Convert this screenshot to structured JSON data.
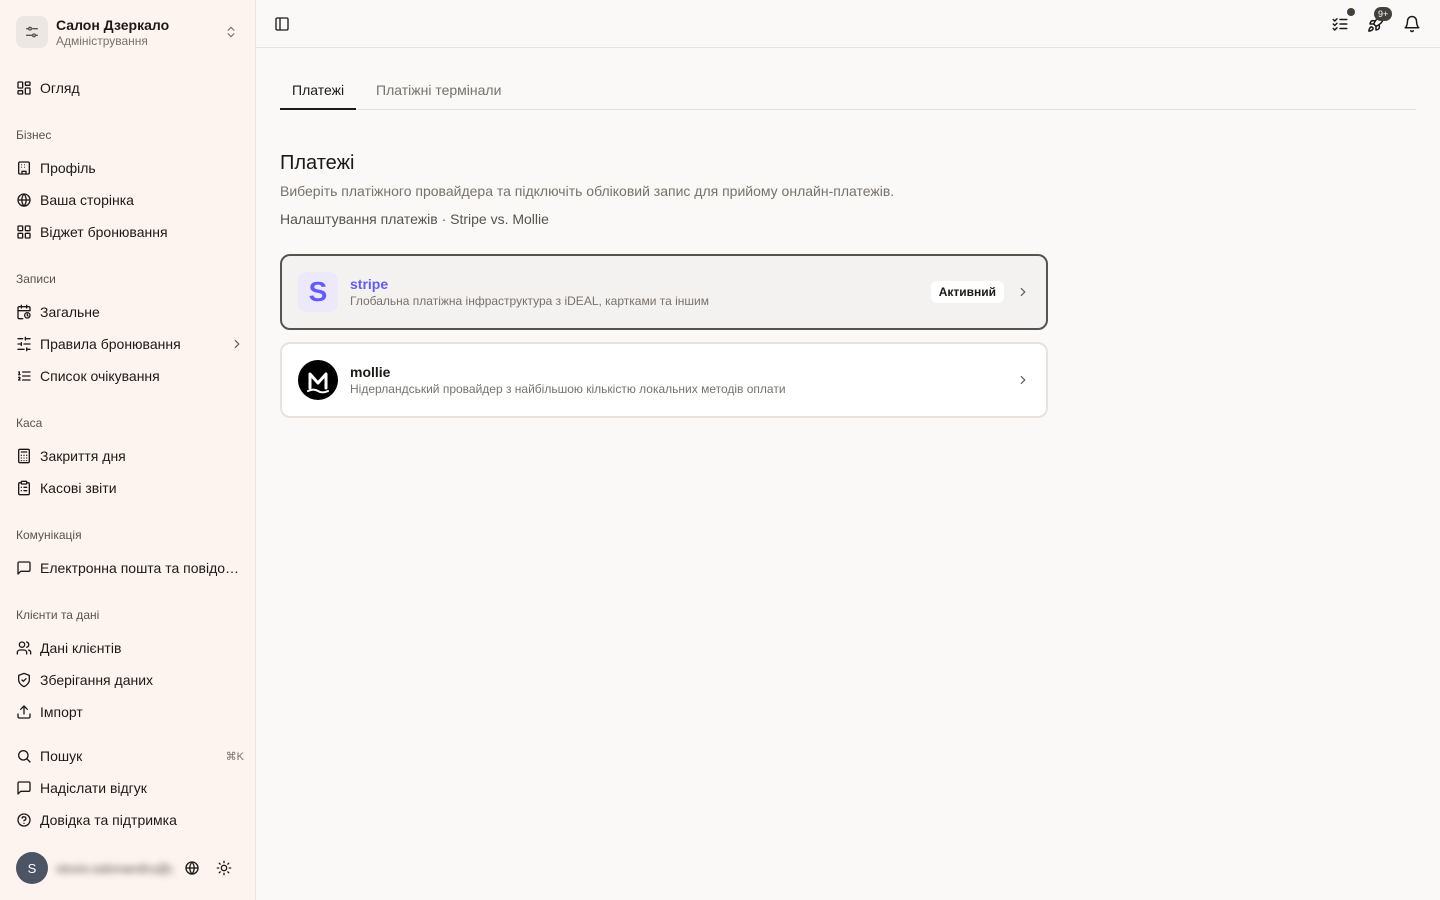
{
  "org": {
    "name": "Салон Дзеркало",
    "role": "Адміністрування"
  },
  "nav": {
    "overview": "Огляд",
    "sections": {
      "business": "Бізнес",
      "appointments": "Записи",
      "cashier": "Каса",
      "communication": "Комунікація",
      "clients_data": "Клієнти та дані"
    },
    "business": [
      "Профіль",
      "Ваша сторінка",
      "Віджет бронювання"
    ],
    "appointments": [
      "Загальне",
      "Правила бронювання",
      "Список очікування"
    ],
    "cashier": [
      "Закриття дня",
      "Касові звіти"
    ],
    "communication": [
      "Електронна пошта та повідомлення"
    ],
    "clients_data": [
      "Дані клієнтів",
      "Зберігання даних",
      "Імпорт"
    ],
    "footer": {
      "search": "Пошук",
      "search_shortcut": "⌘K",
      "feedback": "Надіслати відгук",
      "help": "Довідка та підтримка"
    }
  },
  "user": {
    "initial": "S",
    "email": "stoxiv.salonandru@gmail.com"
  },
  "topbar": {
    "notifications_badge": "9+"
  },
  "tabs": [
    "Платежі",
    "Платіжні термінали"
  ],
  "page": {
    "title": "Платежі",
    "description": "Виберіть платіжного провайдера та підключіть обліковий запис для прийому онлайн-платежів.",
    "subtitle": "Налаштування платежів · Stripe vs. Mollie"
  },
  "providers": [
    {
      "name": "stripe",
      "description": "Глобальна платіжна інфраструктура з iDEAL, картками та іншим",
      "status": "Активний",
      "brand_color": "#635bff"
    },
    {
      "name": "mollie",
      "description": "Нідерландський провайдер з найбільшою кількістю локальних методів оплати",
      "brand_color": "#000000"
    }
  ],
  "icons": [
    "sliders-icon",
    "chevrons-up-down-icon",
    "layout-grid-icon",
    "building-icon",
    "globe-icon",
    "calendar-clock-icon",
    "sliders-horizontal-icon",
    "list-ordered-icon",
    "calculator-icon",
    "clipboard-list-icon",
    "message-square-icon",
    "users-icon",
    "shield-check-icon",
    "upload-icon",
    "search-icon",
    "help-circle-icon",
    "sun-icon",
    "sidebar-toggle-icon",
    "list-checks-icon",
    "rocket-icon",
    "bell-icon",
    "chevron-right-icon"
  ]
}
